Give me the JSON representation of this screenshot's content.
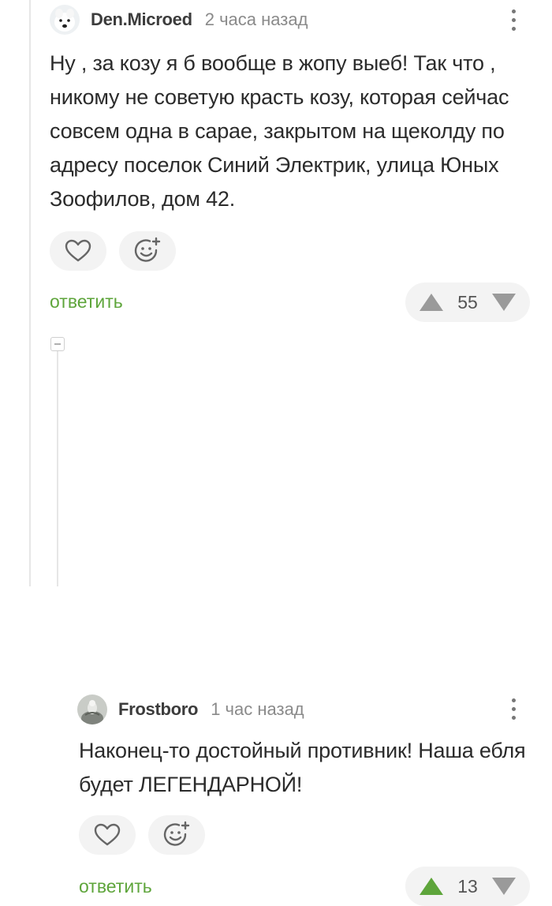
{
  "comments": [
    {
      "username": "Den.Microed",
      "timestamp": "2 часа назад",
      "text": "Ну , за козу я б вообще в жопу выеб! Так что , никому не советую красть козу, которая сейчас совсем одна в сарае, закрытом на щеколду по адресу поселок Синий Электрик, улица Юных Зоофилов, дом 42.",
      "reply_label": "ответить",
      "rating": "55",
      "upvote_color": "#9a9a9a",
      "downvote_color": "#9a9a9a"
    },
    {
      "username": "Frostboro",
      "timestamp": "1 час назад",
      "text": "Наконец-то достойный противник! Наша ебля будет ЛЕГЕНДАРНОЙ!",
      "reply_label": "ответить",
      "rating": "13",
      "upvote_color": "#5ea53b",
      "downvote_color": "#9a9a9a"
    }
  ],
  "icons": {
    "like": "heart-icon",
    "react": "smiley-plus-icon",
    "more": "more-vertical-icon",
    "upvote": "triangle-up-icon",
    "downvote": "triangle-down-icon",
    "collapse": "minus-box-icon"
  },
  "colors": {
    "accent_green": "#5ea53b",
    "pill_bg": "#f3f3f3",
    "muted": "#8a8a8a"
  }
}
